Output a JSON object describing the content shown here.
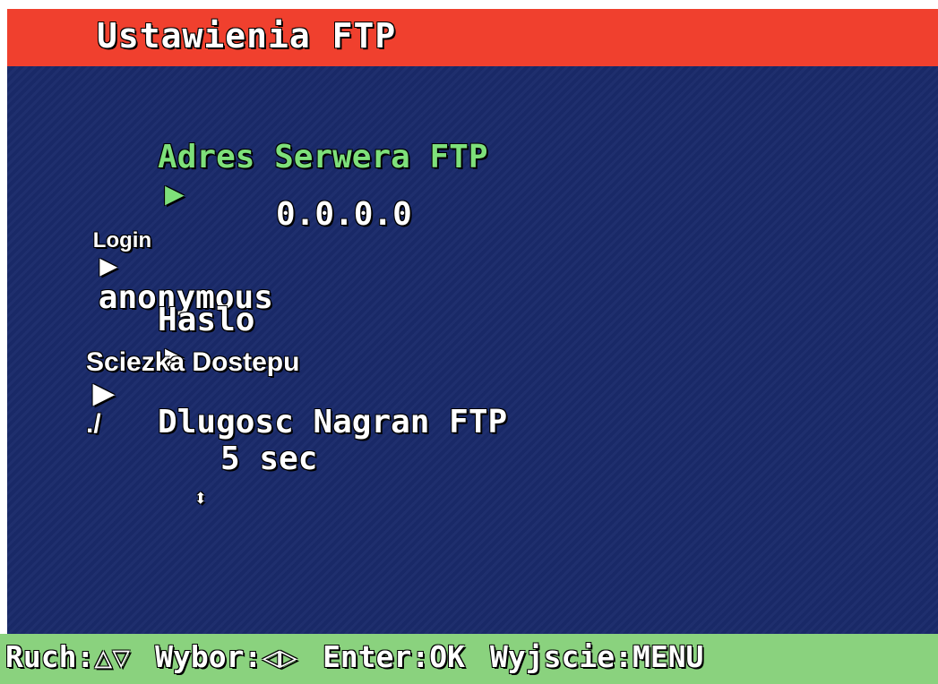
{
  "title": "Ustawienia FTP",
  "menu": {
    "server_label": "Adres Serwera FTP",
    "server_value": "0.0.0.0",
    "login_label": "Login",
    "login_value": "anonymous",
    "password_label": "Haslo",
    "path_label": "Sciezka Dostepu",
    "path_value": "./",
    "duration_label": "Dlugosc Nagran FTP",
    "duration_value": "5 sec"
  },
  "icons": {
    "arrow": "▶",
    "updown": "⬍"
  },
  "footer": {
    "move_label": "Ruch:",
    "move_icons": "△▽",
    "select_label": "Wybor:",
    "select_icons": "◁▷",
    "enter_label": "Enter:OK",
    "exit_label": "Wyjscie:MENU"
  },
  "colors": {
    "title_bar": "#f0402e",
    "panel": "#1a2a6a",
    "selected_text": "#7ee07a",
    "footer": "#8ad27e"
  }
}
